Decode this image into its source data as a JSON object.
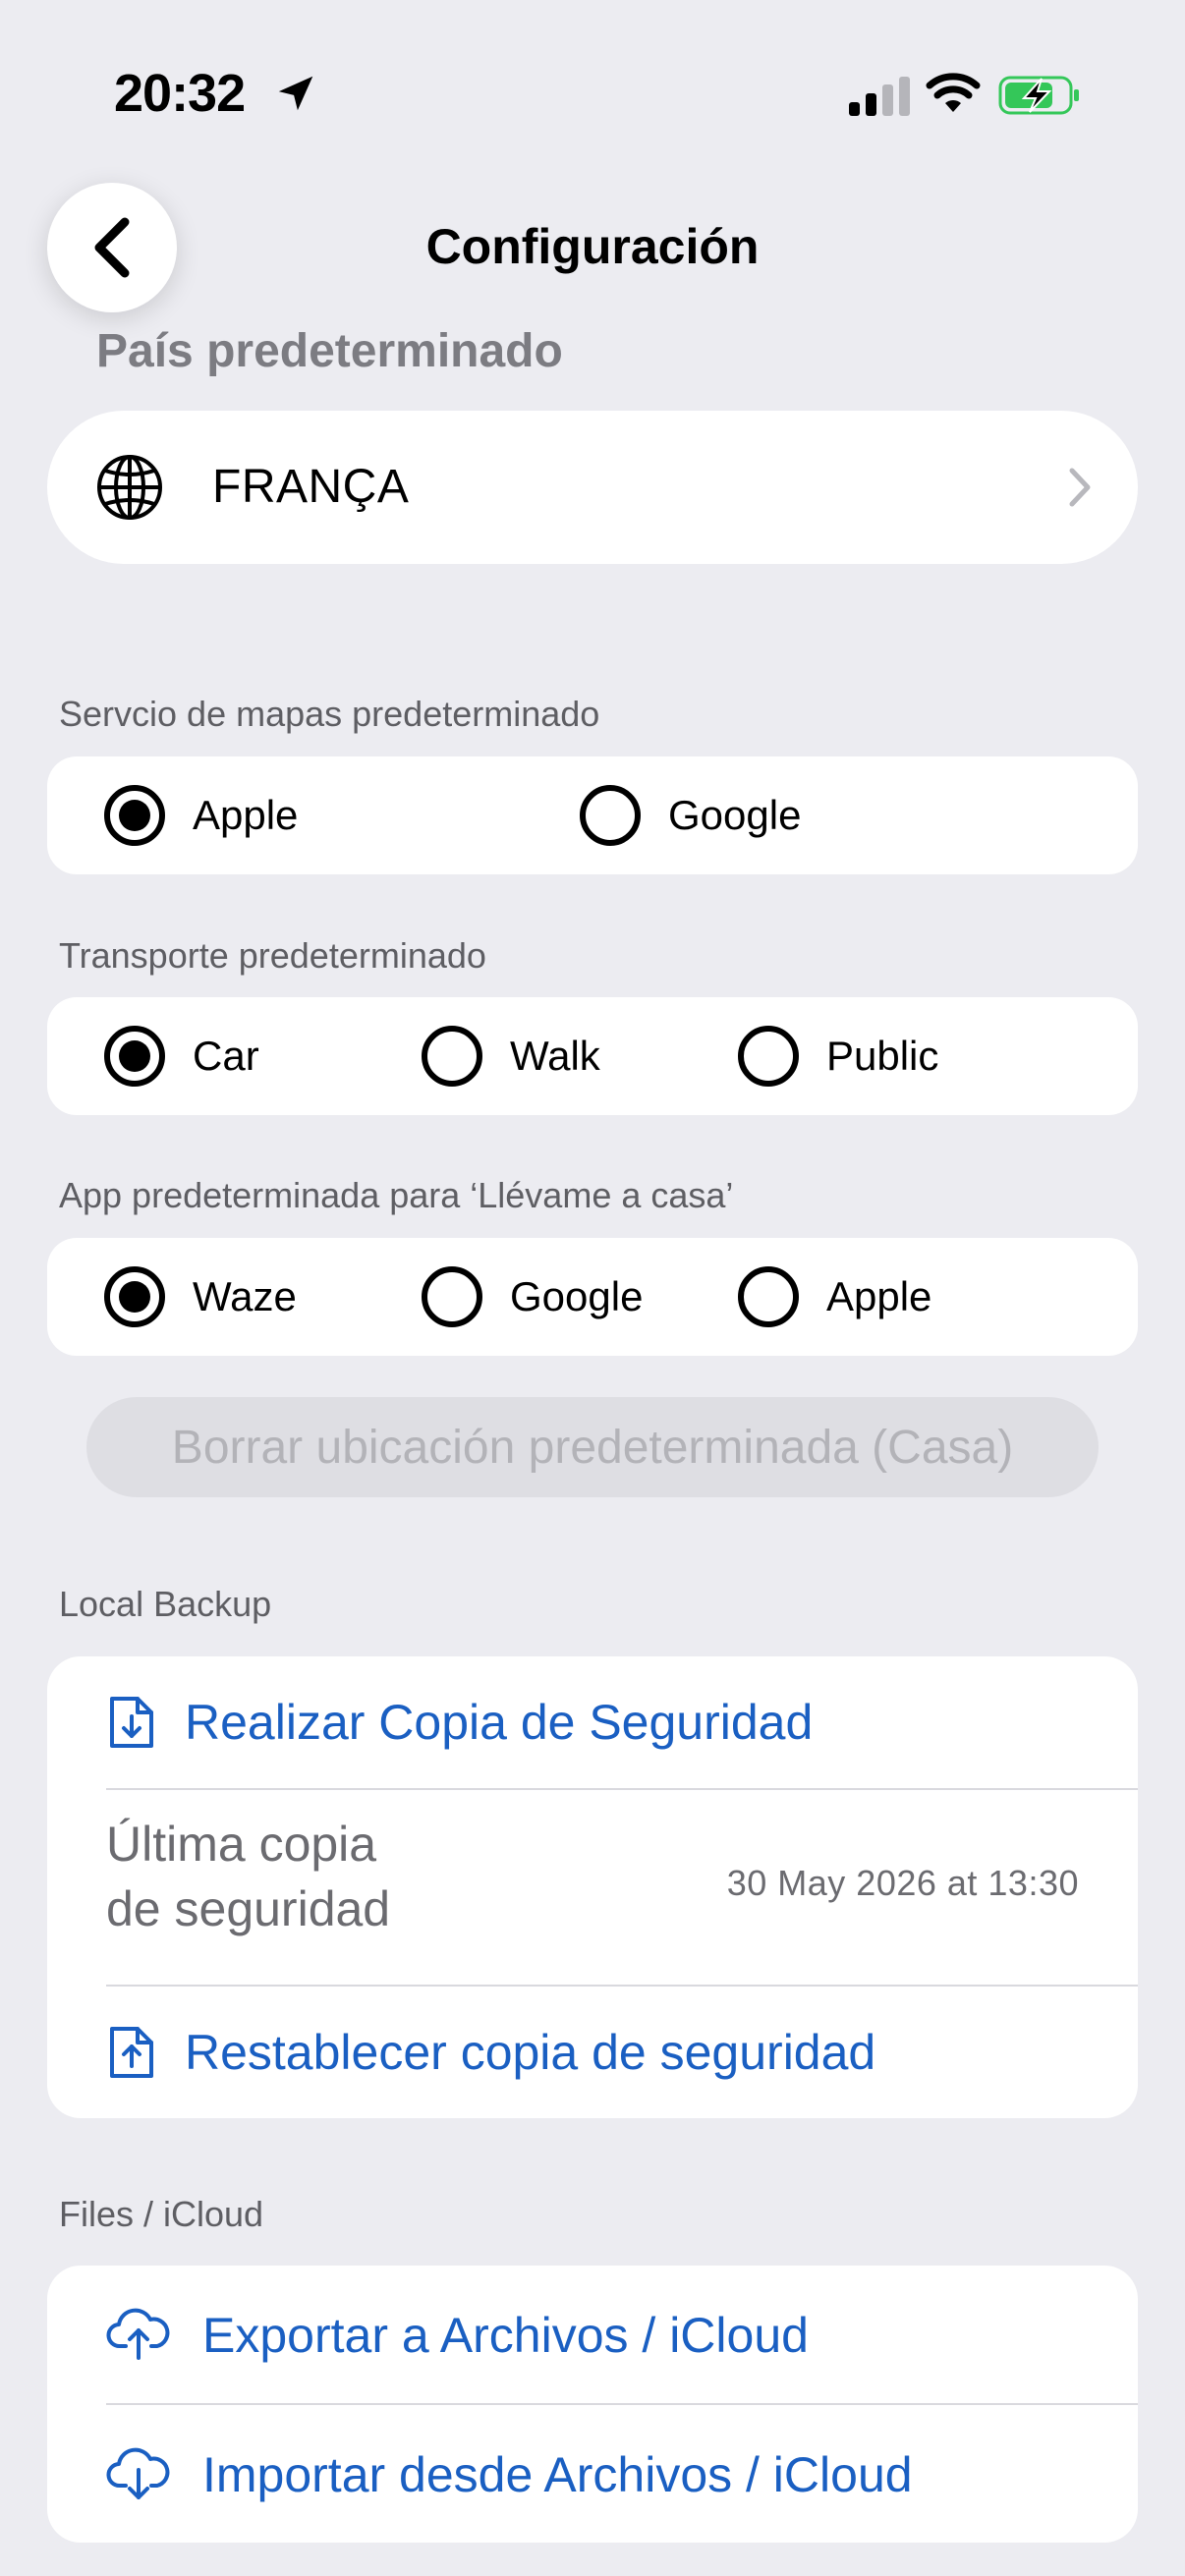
{
  "status_bar": {
    "time": "20:32"
  },
  "nav": {
    "title": "Configuración"
  },
  "country": {
    "heading": "País predeterminado",
    "value": "FRANÇA"
  },
  "maps_service": {
    "label": "Servcio de mapas predeterminado",
    "options": [
      {
        "label": "Apple",
        "selected": true
      },
      {
        "label": "Google",
        "selected": false
      }
    ]
  },
  "transport": {
    "label": "Transporte predeterminado",
    "options": [
      {
        "label": "Car",
        "selected": true
      },
      {
        "label": "Walk",
        "selected": false
      },
      {
        "label": "Public",
        "selected": false
      }
    ]
  },
  "home_app": {
    "label": "App predeterminada para ‘Llévame a casa’",
    "options": [
      {
        "label": "Waze",
        "selected": true
      },
      {
        "label": "Google",
        "selected": false
      },
      {
        "label": "Apple",
        "selected": false
      }
    ]
  },
  "clear_home_button": "Borrar ubicación predeterminada (Casa)",
  "local_backup": {
    "label": "Local Backup",
    "make_backup": "Realizar Copia de Seguridad",
    "last_backup_label_line1": "Última copia",
    "last_backup_label_line2": "de seguridad",
    "last_backup_value": "30 May 2026 at 13:30",
    "restore_backup": "Restablecer copia de seguridad"
  },
  "files_icloud": {
    "label": "Files / iCloud",
    "export": "Exportar a Archivos / iCloud",
    "import": "Importar desde Archivos / iCloud"
  },
  "colors": {
    "background": "#ececf1",
    "card": "#ffffff",
    "link": "#1a5fc2",
    "battery": "#34c759"
  }
}
